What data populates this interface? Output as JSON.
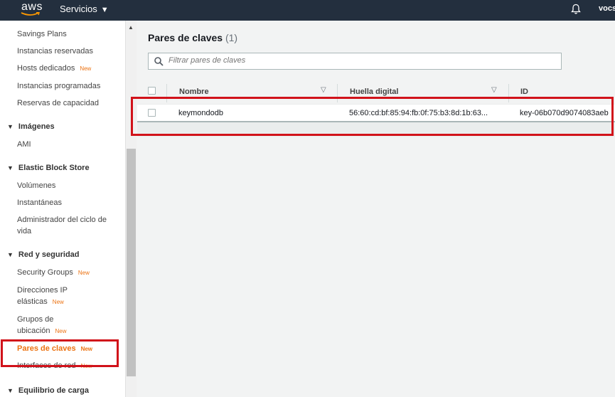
{
  "header": {
    "logo": "aws",
    "services_label": "Servicios",
    "user_label": "vocst"
  },
  "sidebar": {
    "items": [
      {
        "label": "Savings Plans"
      },
      {
        "label": "Instancias reservadas"
      },
      {
        "label": "Hosts dedicados",
        "badge": "New"
      },
      {
        "label": "Instancias programadas"
      },
      {
        "label": "Reservas de capacidad"
      },
      {
        "section": "Imágenes"
      },
      {
        "label": "AMI"
      },
      {
        "section": "Elastic Block Store"
      },
      {
        "label": "Volúmenes"
      },
      {
        "label": "Instantáneas"
      },
      {
        "label": "Administrador del ciclo de vida"
      },
      {
        "section": "Red y seguridad"
      },
      {
        "label": "Security Groups",
        "badge": "New"
      },
      {
        "label": "Direcciones IP elásticas",
        "badge": "New"
      },
      {
        "label": "Grupos de ubicación",
        "badge": "New"
      },
      {
        "label": "Pares de claves",
        "badge": "New",
        "active": true
      },
      {
        "label": "Interfaces de red",
        "badge": "New"
      },
      {
        "section": "Equilibrio de carga"
      }
    ]
  },
  "main": {
    "title": "Pares de claves",
    "count": "(1)",
    "search_placeholder": "Filtrar pares de claves",
    "columns": [
      "Nombre",
      "Huella digital",
      "ID"
    ],
    "rows": [
      {
        "name": "keymondodb",
        "fingerprint": "56:60:cd:bf:85:94:fb:0f:75:b3:8d:1b:63...",
        "id": "key-06b070d9074083aeb"
      }
    ]
  },
  "colors": {
    "topbar": "#232f3e",
    "accent": "#ec7211",
    "highlight_box": "#d1121a"
  },
  "icons": [
    "bell-icon",
    "search-icon",
    "sort-icon",
    "caret-down-icon",
    "collapse-triangle-icon"
  ]
}
